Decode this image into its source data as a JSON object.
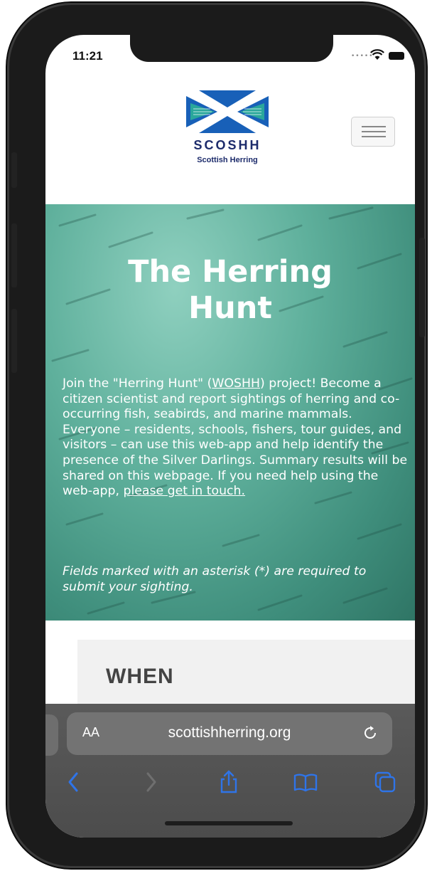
{
  "status_bar": {
    "time": "11:21"
  },
  "header": {
    "logo_name": "SCOSHH",
    "logo_subtitle": "Scottish Herring",
    "menu_icon": "hamburger-icon"
  },
  "hero": {
    "title": "The Herring Hunt",
    "intro_before_link": "Join the \"Herring Hunt\" (",
    "project_link": "WOSHH",
    "intro_after_link": ") project! Become a citizen scientist and report sightings of herring and co-occurring fish, seabirds, and marine mammals. Everyone – residents, schools, fishers, tour guides, and visitors – can use this web-app and help identify the presence of the Silver Darlings. Summary results will be shared on this webpage. If you need help using the web-app, ",
    "contact_link": "please get in touch.",
    "required_note": "Fields marked with an asterisk (*) are required to submit your sighting."
  },
  "form": {
    "section_title": "WHEN"
  },
  "browser": {
    "text_size_label": "AA",
    "url": "scottishherring.org",
    "accent_color": "#2f74e8"
  },
  "colors": {
    "brand_navy": "#1c2b6b",
    "brand_teal": "#2aa79b",
    "flag_blue": "#1860b8"
  }
}
